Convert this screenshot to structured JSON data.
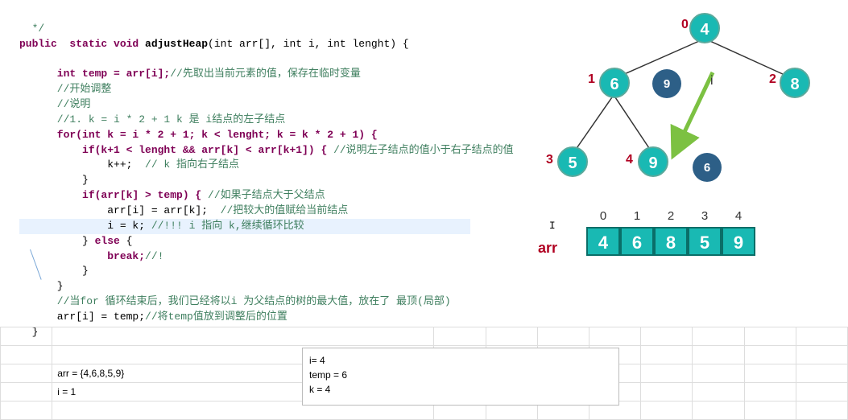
{
  "code": {
    "l1": "  */",
    "l2a": "public  static void ",
    "l2_fn": "adjustHeap",
    "l2b": "(int arr[], int i, int lenght) {",
    "l3": "",
    "l4a": "      int temp = arr[i];",
    "l4c": "//先取出当前元素的值，保存在临时变量",
    "l5": "      //开始调整",
    "l6": "      //说明",
    "l7": "      //1. k = i * 2 + 1 k 是 i结点的左子结点",
    "l8a": "      for(int k = i * 2 + 1; k < lenght; k = k * 2 + 1) {",
    "l9a": "          if(k+1 < lenght && arr[k] < arr[k+1]) { ",
    "l9c": "//说明左子结点的值小于右子结点的值",
    "l10a": "              k++;  ",
    "l10c": "// k 指向右子结点",
    "l11": "          }",
    "l12a": "          if(arr[k] > temp) { ",
    "l12c": "//如果子结点大于父结点",
    "l13a": "              arr[i] = arr[k]; ",
    "l13c": " //把较大的值赋给当前结点",
    "l14a": "              i = k; ",
    "l14c": "//!!! i 指向 k,继续循环比较",
    "l15": "          } else {",
    "l16a": "              break;",
    "l16c": "//!",
    "l17": "          }",
    "l18": "      }",
    "l19": "      //当for 循环结束后，我们已经将以i 为父结点的树的最大值，放在了 最顶(局部)",
    "l20a": "      arr[i] = temp;",
    "l20c": "//将temp值放到调整后的位置",
    "l21": "  }"
  },
  "nodes": {
    "n0": "4",
    "n1": "6",
    "n2": "8",
    "n3": "5",
    "n4": "9",
    "g9": "9",
    "g6": "6"
  },
  "indices": {
    "i0": "0",
    "i1": "1",
    "i2": "2",
    "i3": "3",
    "i4": "4"
  },
  "iLabel": "i",
  "arr": {
    "label": "arr",
    "idx": [
      "0",
      "1",
      "2",
      "3",
      "4"
    ],
    "vals": [
      "4",
      "6",
      "8",
      "5",
      "9"
    ]
  },
  "cell1": {
    "a": "arr = {4,6,8,5,9}",
    "b": "i = 1"
  },
  "cell2": {
    "a": "i= 4",
    "b": "temp = 6",
    "c": "k = 4"
  }
}
